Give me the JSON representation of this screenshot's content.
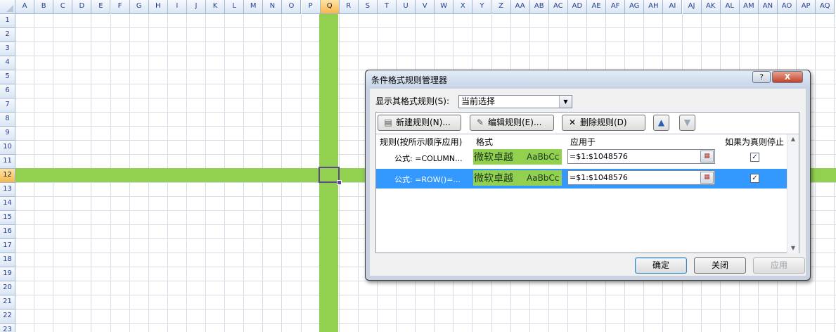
{
  "sheet": {
    "columns": [
      "A",
      "B",
      "C",
      "D",
      "E",
      "F",
      "G",
      "H",
      "I",
      "J",
      "K",
      "L",
      "M",
      "N",
      "O",
      "P",
      "Q",
      "R",
      "S",
      "T",
      "U",
      "V",
      "W",
      "X",
      "Y",
      "Z",
      "AA",
      "AB",
      "AC",
      "AD",
      "AE",
      "AF",
      "AG",
      "AH",
      "AI",
      "AJ",
      "AK",
      "AL",
      "AM",
      "AN",
      "AO",
      "AP",
      "AQ"
    ],
    "rows": [
      "1",
      "2",
      "3",
      "4",
      "5",
      "6",
      "7",
      "8",
      "9",
      "10",
      "11",
      "12",
      "13",
      "14",
      "15",
      "16",
      "17",
      "18",
      "19",
      "20",
      "21",
      "22",
      "23"
    ],
    "selected_column": "Q",
    "selected_row": "12",
    "highlight_color": "#92d050"
  },
  "dialog": {
    "title": "条件格式规则管理器",
    "help_label": "?",
    "close_label": "X",
    "show_rules_label": "显示其格式规则(S):",
    "scope_value": "当前选择",
    "buttons": {
      "new_rule": "新建规则(N)...",
      "edit_rule": "编辑规则(E)...",
      "delete_rule": "删除规则(D)",
      "ok": "确定",
      "close": "关闭",
      "apply": "应用"
    },
    "columns": {
      "rule": "规则(按所示顺序应用)",
      "format": "格式",
      "applies_to": "应用于",
      "stop_if_true": "如果为真则停止"
    },
    "rules": [
      {
        "rule": "公式: =COLUMN...",
        "format_preview_zh": "微软卓越",
        "format_preview_en": "AaBbCc",
        "applies_to": "=$1:$1048576",
        "stop_if_true": true,
        "selected": false
      },
      {
        "rule": "公式: =ROW()=...",
        "format_preview_zh": "微软卓越",
        "format_preview_en": "AaBbCc",
        "applies_to": "=$1:$1048576",
        "stop_if_true": true,
        "selected": true
      }
    ]
  }
}
